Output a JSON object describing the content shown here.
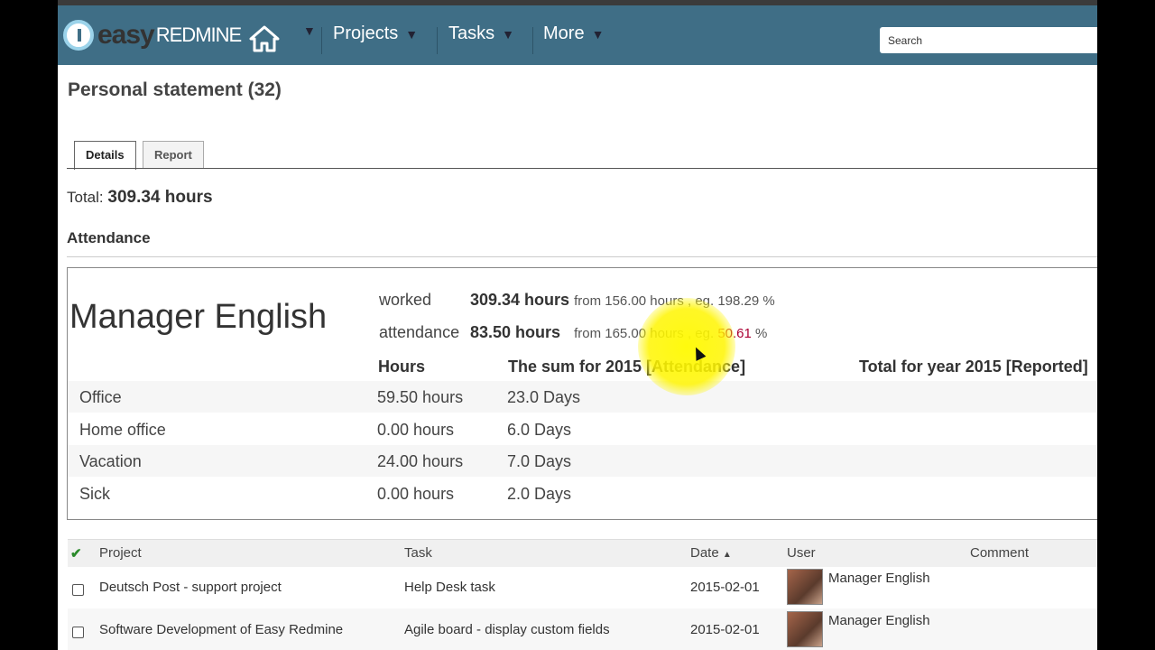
{
  "header": {
    "logo_easy": "easy",
    "logo_redmine": "REDMINE",
    "nav": [
      "Projects",
      "Tasks",
      "More"
    ],
    "search_placeholder": "Search"
  },
  "page": {
    "title": "Personal statement (32)"
  },
  "tabs": [
    {
      "label": "Details",
      "active": true
    },
    {
      "label": "Report",
      "active": false
    }
  ],
  "total": {
    "label": "Total:",
    "value": "309.34 hours"
  },
  "attendance": {
    "heading": "Attendance",
    "name": "Manager English",
    "worked": {
      "label": "worked",
      "value": "309.34 hours",
      "from": "from 156.00 hours , eg. 198.29 %"
    },
    "att": {
      "label": "attendance",
      "value": "83.50 hours",
      "from_a": "from 165.00 hours , eg. ",
      "pct": "50.61",
      "from_b": " %"
    },
    "columns": [
      "Hours",
      "The sum for 2015 [Attendance]",
      "Total for year 2015 [Reported]"
    ],
    "rows": [
      {
        "type": "Office",
        "hours": "59.50 hours",
        "days": "23.0 Days"
      },
      {
        "type": "Home office",
        "hours": "0.00 hours",
        "days": "6.0 Days"
      },
      {
        "type": "Vacation",
        "hours": "24.00 hours",
        "days": "7.0 Days"
      },
      {
        "type": "Sick",
        "hours": "0.00 hours",
        "days": "2.0 Days"
      }
    ]
  },
  "table": {
    "columns": [
      "Project",
      "Task",
      "Date",
      "User",
      "Comment"
    ],
    "rows": [
      {
        "project": "Deutsch Post - support project",
        "task": "Help Desk task",
        "date": "2015-02-01",
        "user": "Manager English"
      },
      {
        "project": "Software Development of Easy Redmine",
        "task": "Agile board - display custom fields",
        "date": "2015-02-01",
        "user": "Manager English"
      }
    ]
  }
}
